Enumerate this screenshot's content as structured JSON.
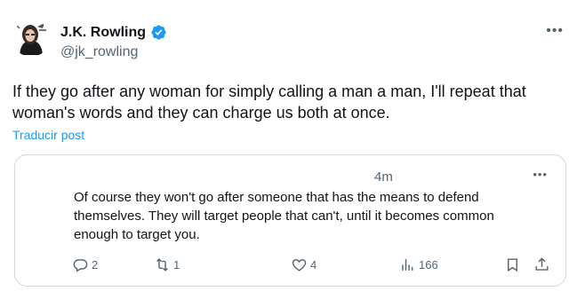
{
  "author": {
    "name": "J.K. Rowling",
    "handle": "@jk_rowling"
  },
  "tweet": {
    "text": "If they go after any woman for simply calling a man a man, I'll repeat that woman's words and they can charge us both at once.",
    "translate_label": "Traducir post"
  },
  "menu": {
    "more_label": "•••"
  },
  "quote": {
    "time": "4m",
    "text": "Of course they won't go after someone that has the means to defend themselves. They will target people that can't, until it becomes common enough to target you.",
    "more_label": "•••",
    "actions": {
      "replies": "2",
      "reposts": "1",
      "likes": "4",
      "views": "166"
    }
  },
  "colors": {
    "accent": "#1d9bf0",
    "secondary_text": "#536471",
    "border": "#cfd9de"
  },
  "icons": [
    "verified-badge-icon",
    "more-icon",
    "reply-icon",
    "repost-icon",
    "like-icon",
    "views-icon",
    "bookmark-icon",
    "share-icon"
  ]
}
